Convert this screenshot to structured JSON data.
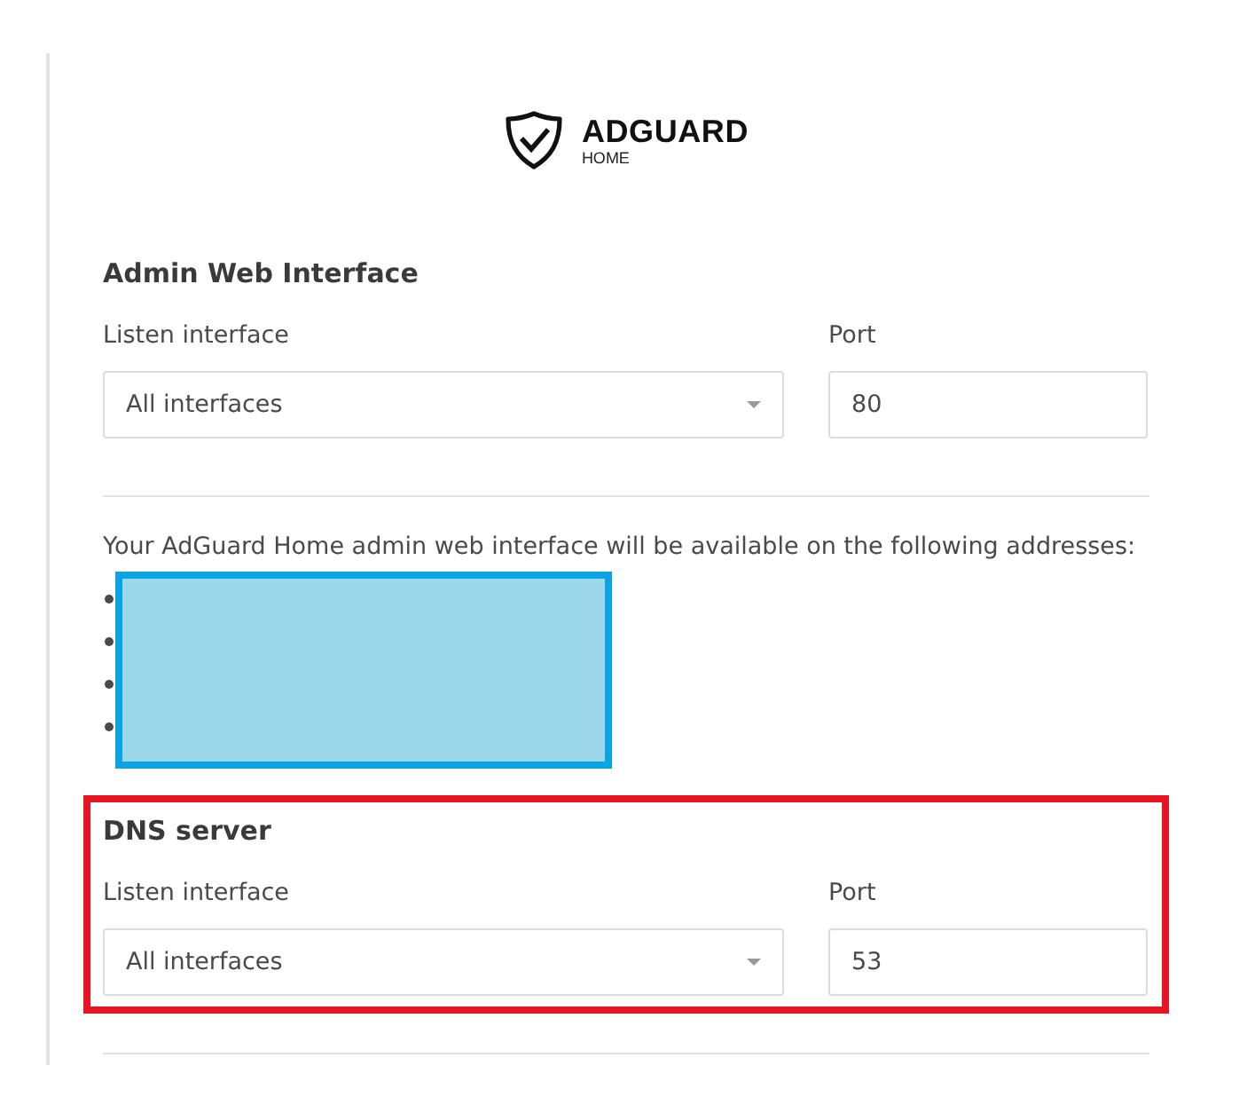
{
  "logo": {
    "name": "ADGUARD",
    "subtitle": "HOME"
  },
  "admin_web_interface": {
    "title": "Admin Web Interface",
    "interface_label": "Listen interface",
    "interface_value": "All interfaces",
    "port_label": "Port",
    "port_value": "80"
  },
  "addresses_note": "Your AdGuard Home admin web interface will be available on the following addresses:",
  "addresses": [
    {
      "redacted": true
    },
    {
      "redacted": true
    },
    {
      "redacted": true
    },
    {
      "redacted": true
    }
  ],
  "dns_server": {
    "title": "DNS server",
    "highlighted": true,
    "interface_label": "Listen interface",
    "interface_value": "All interfaces",
    "port_label": "Port",
    "port_value": "53"
  }
}
